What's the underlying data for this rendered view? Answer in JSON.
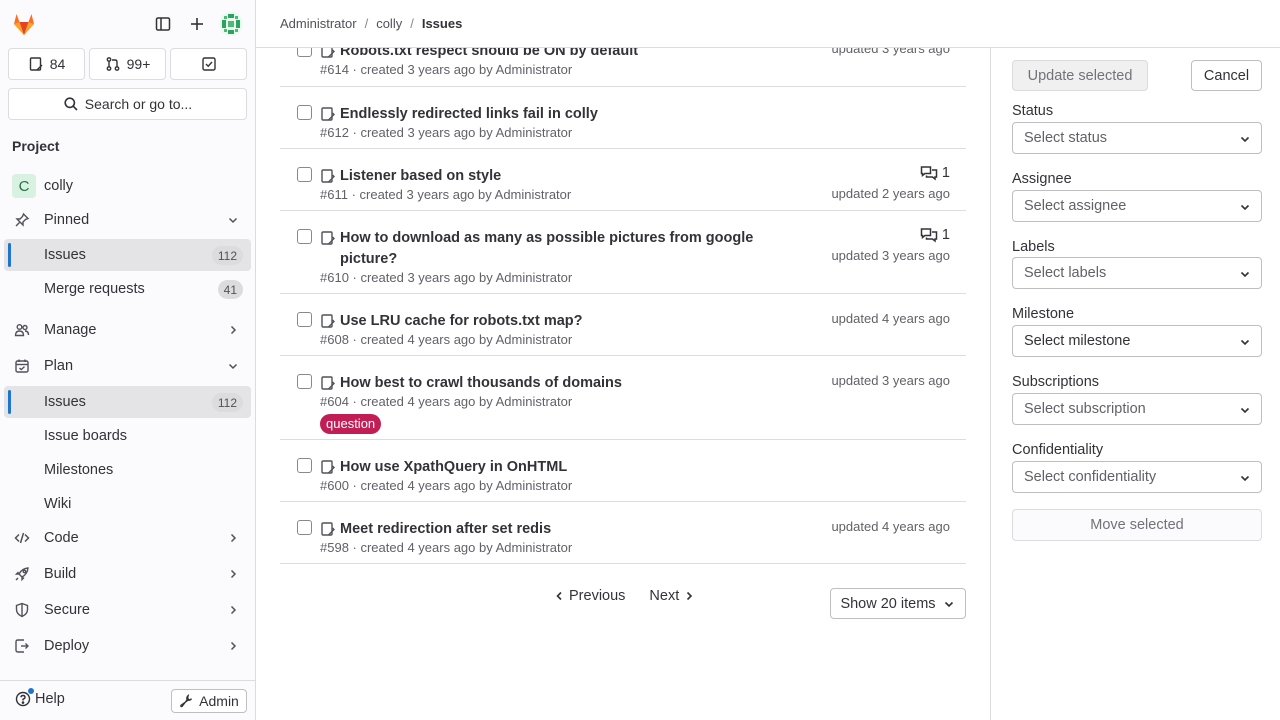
{
  "sidebar": {
    "counts": {
      "issues": "84",
      "merge_requests": "99+"
    },
    "search_label": "Search or go to...",
    "section_title": "Project",
    "project": {
      "letter": "C",
      "name": "colly"
    },
    "items": [
      {
        "label": "Pinned"
      },
      {
        "label": "Issues",
        "badge": "112"
      },
      {
        "label": "Merge requests",
        "badge": "41"
      },
      {
        "label": "Manage"
      },
      {
        "label": "Plan"
      },
      {
        "label": "Issues",
        "badge": "112"
      },
      {
        "label": "Issue boards"
      },
      {
        "label": "Milestones"
      },
      {
        "label": "Wiki"
      },
      {
        "label": "Code"
      },
      {
        "label": "Build"
      },
      {
        "label": "Secure"
      },
      {
        "label": "Deploy"
      }
    ],
    "help_label": "Help",
    "admin_label": "Admin"
  },
  "breadcrumb": {
    "items": [
      "Administrator",
      "colly"
    ],
    "current": "Issues"
  },
  "issues": [
    {
      "title": "Robots.txt respect should be ON by default",
      "meta": "#614 · created 3 years ago by Administrator",
      "updated": "updated 3 years ago"
    },
    {
      "title": "Endlessly redirected links fail in colly",
      "meta": "#612 · created 3 years ago by Administrator"
    },
    {
      "title": "Listener based on style",
      "meta": "#611 · created 3 years ago by Administrator",
      "comments": "1",
      "updated": "updated 2 years ago"
    },
    {
      "title": "How to download as many as possible pictures from google picture?",
      "meta": "#610 · created 3 years ago by Administrator",
      "comments": "1",
      "updated": "updated 3 years ago"
    },
    {
      "title": "Use LRU cache for robots.txt map?",
      "meta": "#608 · created 4 years ago by Administrator",
      "updated": "updated 4 years ago"
    },
    {
      "title": "How best to crawl thousands of domains",
      "meta": "#604 · created 4 years ago by Administrator",
      "label": "question",
      "updated": "updated 3 years ago"
    },
    {
      "title": "How use XpathQuery in OnHTML",
      "meta": "#600 · created 4 years ago by Administrator"
    },
    {
      "title": "Meet redirection after set redis",
      "meta": "#598 · created 4 years ago by Administrator",
      "updated": "updated 4 years ago"
    }
  ],
  "pagination": {
    "previous": "Previous",
    "next": "Next",
    "page_size": "Show 20 items"
  },
  "bulk_edit": {
    "update_label": "Update selected",
    "cancel_label": "Cancel",
    "fields": [
      {
        "label": "Status",
        "placeholder": "Select status"
      },
      {
        "label": "Assignee",
        "placeholder": "Select assignee"
      },
      {
        "label": "Labels",
        "placeholder": "Select labels"
      },
      {
        "label": "Milestone",
        "placeholder": "Select milestone"
      },
      {
        "label": "Subscriptions",
        "placeholder": "Select subscription"
      },
      {
        "label": "Confidentiality",
        "placeholder": "Select confidentiality"
      }
    ],
    "move_label": "Move selected"
  },
  "colors": {
    "accent": "#1f75cb",
    "label_question": "#c21e56",
    "brand": "#fc6d26"
  }
}
